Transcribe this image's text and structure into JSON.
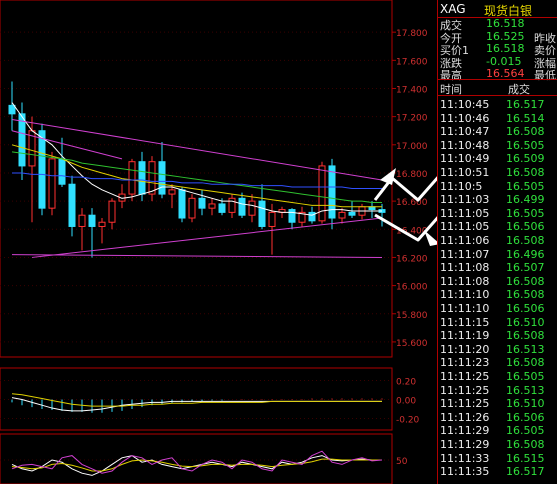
{
  "quote": {
    "code": "XAG",
    "name": "现货白银",
    "rows": [
      {
        "label": "成交",
        "value": "16.518",
        "extra": ""
      },
      {
        "label": "今开",
        "value": "16.525",
        "extra": "昨收"
      },
      {
        "label": "买价1",
        "value": "16.518",
        "extra": "卖价"
      },
      {
        "label": "涨跌",
        "value": "-0.015",
        "extra": "涨幅"
      },
      {
        "label": "最高",
        "value": "16.564",
        "extra": "最低"
      }
    ]
  },
  "ticks": {
    "header_time": "时间",
    "header_price": "成交",
    "rows": [
      {
        "time": "11:10:45",
        "price": "16.517"
      },
      {
        "time": "11:10:46",
        "price": "16.514"
      },
      {
        "time": "11:10:47",
        "price": "16.508"
      },
      {
        "time": "11:10:48",
        "price": "16.505"
      },
      {
        "time": "11:10:49",
        "price": "16.509"
      },
      {
        "time": "11:10:51",
        "price": "16.508"
      },
      {
        "time": "11:10:5",
        "price": "16.505"
      },
      {
        "time": "11:11:03",
        "price": "16.499"
      },
      {
        "time": "11:11:05",
        "price": "16.505"
      },
      {
        "time": "11:11:05",
        "price": "16.506"
      },
      {
        "time": "11:11:06",
        "price": "16.508"
      },
      {
        "time": "11:11:07",
        "price": "16.496"
      },
      {
        "time": "11:11:08",
        "price": "16.507"
      },
      {
        "time": "11:11:08",
        "price": "16.508"
      },
      {
        "time": "11:11:10",
        "price": "16.508"
      },
      {
        "time": "11:11:10",
        "price": "16.506"
      },
      {
        "time": "11:11:15",
        "price": "16.510"
      },
      {
        "time": "11:11:19",
        "price": "16.508"
      },
      {
        "time": "11:11:20",
        "price": "16.513"
      },
      {
        "time": "11:11:23",
        "price": "16.508"
      },
      {
        "time": "11:11:25",
        "price": "16.505"
      },
      {
        "time": "11:11:25",
        "price": "16.513"
      },
      {
        "time": "11:11:25",
        "price": "16.510"
      },
      {
        "time": "11:11:26",
        "price": "16.506"
      },
      {
        "time": "11:11:29",
        "price": "16.505"
      },
      {
        "time": "11:11:29",
        "price": "16.508"
      },
      {
        "time": "11:11:33",
        "price": "16.515"
      },
      {
        "time": "11:11:35",
        "price": "16.517"
      }
    ]
  },
  "chart_data": [
    {
      "type": "candlestick",
      "ylim": [
        15.5,
        18.0
      ],
      "yticks": [
        "17.800",
        "17.600",
        "17.400",
        "17.200",
        "17.000",
        "16.800",
        "16.600",
        "16.400",
        "16.200",
        "16.000",
        "15.800",
        "15.600"
      ],
      "candles": [
        {
          "o": 17.28,
          "h": 17.45,
          "l": 17.1,
          "c": 17.22
        },
        {
          "o": 17.22,
          "h": 17.3,
          "l": 16.75,
          "c": 16.85
        },
        {
          "o": 16.85,
          "h": 17.2,
          "l": 16.45,
          "c": 17.1
        },
        {
          "o": 17.1,
          "h": 17.15,
          "l": 16.5,
          "c": 16.55
        },
        {
          "o": 16.55,
          "h": 16.95,
          "l": 16.5,
          "c": 16.9
        },
        {
          "o": 16.9,
          "h": 17.05,
          "l": 16.7,
          "c": 16.72
        },
        {
          "o": 16.72,
          "h": 16.78,
          "l": 16.35,
          "c": 16.42
        },
        {
          "o": 16.42,
          "h": 16.55,
          "l": 16.25,
          "c": 16.5
        },
        {
          "o": 16.5,
          "h": 16.55,
          "l": 16.2,
          "c": 16.42
        },
        {
          "o": 16.42,
          "h": 16.48,
          "l": 16.3,
          "c": 16.45
        },
        {
          "o": 16.45,
          "h": 16.62,
          "l": 16.4,
          "c": 16.6
        },
        {
          "o": 16.6,
          "h": 16.72,
          "l": 16.55,
          "c": 16.65
        },
        {
          "o": 16.65,
          "h": 16.9,
          "l": 16.6,
          "c": 16.88
        },
        {
          "o": 16.88,
          "h": 16.95,
          "l": 16.6,
          "c": 16.65
        },
        {
          "o": 16.65,
          "h": 16.92,
          "l": 16.6,
          "c": 16.88
        },
        {
          "o": 16.88,
          "h": 17.02,
          "l": 16.62,
          "c": 16.65
        },
        {
          "o": 16.65,
          "h": 16.72,
          "l": 16.55,
          "c": 16.68
        },
        {
          "o": 16.68,
          "h": 16.7,
          "l": 16.45,
          "c": 16.48
        },
        {
          "o": 16.48,
          "h": 16.65,
          "l": 16.45,
          "c": 16.62
        },
        {
          "o": 16.62,
          "h": 16.68,
          "l": 16.5,
          "c": 16.55
        },
        {
          "o": 16.55,
          "h": 16.62,
          "l": 16.5,
          "c": 16.58
        },
        {
          "o": 16.58,
          "h": 16.62,
          "l": 16.5,
          "c": 16.52
        },
        {
          "o": 16.52,
          "h": 16.65,
          "l": 16.48,
          "c": 16.62
        },
        {
          "o": 16.62,
          "h": 16.66,
          "l": 16.48,
          "c": 16.5
        },
        {
          "o": 16.5,
          "h": 16.65,
          "l": 16.45,
          "c": 16.6
        },
        {
          "o": 16.6,
          "h": 16.72,
          "l": 16.4,
          "c": 16.42
        },
        {
          "o": 16.42,
          "h": 16.58,
          "l": 16.22,
          "c": 16.52
        },
        {
          "o": 16.52,
          "h": 16.56,
          "l": 16.48,
          "c": 16.54
        },
        {
          "o": 16.54,
          "h": 16.55,
          "l": 16.4,
          "c": 16.45
        },
        {
          "o": 16.45,
          "h": 16.56,
          "l": 16.42,
          "c": 16.52
        },
        {
          "o": 16.52,
          "h": 16.56,
          "l": 16.44,
          "c": 16.46
        },
        {
          "o": 16.46,
          "h": 16.88,
          "l": 16.44,
          "c": 16.85
        },
        {
          "o": 16.85,
          "h": 16.9,
          "l": 16.4,
          "c": 16.48
        },
        {
          "o": 16.48,
          "h": 16.55,
          "l": 16.44,
          "c": 16.52
        },
        {
          "o": 16.52,
          "h": 16.6,
          "l": 16.48,
          "c": 16.5
        },
        {
          "o": 16.5,
          "h": 16.58,
          "l": 16.47,
          "c": 16.56
        },
        {
          "o": 16.56,
          "h": 16.6,
          "l": 16.48,
          "c": 16.54
        },
        {
          "o": 16.54,
          "h": 16.58,
          "l": 16.42,
          "c": 16.52
        }
      ],
      "ma_lines": [
        {
          "color": "#ffffff",
          "values": [
            17.3,
            17.2,
            17.1,
            17.05,
            17.0,
            16.92,
            16.85,
            16.78,
            16.72,
            16.68,
            16.65,
            16.62,
            16.63,
            16.65,
            16.67,
            16.7,
            16.7,
            16.68,
            16.66,
            16.64,
            16.62,
            16.6,
            16.6,
            16.58,
            16.57,
            16.55,
            16.53,
            16.52,
            16.52,
            16.51,
            16.5,
            16.53,
            16.54,
            16.54,
            16.53,
            16.53,
            16.53,
            16.53
          ]
        },
        {
          "color": "#e0d000",
          "values": [
            17.0,
            16.98,
            16.96,
            16.94,
            16.92,
            16.9,
            16.87,
            16.84,
            16.82,
            16.8,
            16.78,
            16.76,
            16.75,
            16.74,
            16.73,
            16.72,
            16.71,
            16.7,
            16.69,
            16.68,
            16.67,
            16.66,
            16.65,
            16.64,
            16.63,
            16.62,
            16.61,
            16.6,
            16.59,
            16.58,
            16.57,
            16.57,
            16.57,
            16.56,
            16.56,
            16.56,
            16.56,
            16.56
          ]
        },
        {
          "color": "#2fc02f",
          "values": [
            16.95,
            16.94,
            16.93,
            16.92,
            16.91,
            16.9,
            16.89,
            16.87,
            16.86,
            16.85,
            16.84,
            16.83,
            16.82,
            16.81,
            16.8,
            16.79,
            16.78,
            16.77,
            16.76,
            16.75,
            16.74,
            16.73,
            16.72,
            16.71,
            16.7,
            16.69,
            16.68,
            16.67,
            16.66,
            16.65,
            16.64,
            16.63,
            16.62,
            16.61,
            16.6,
            16.6,
            16.59,
            16.59
          ]
        },
        {
          "color": "#3050ff",
          "values": [
            16.8,
            16.8,
            16.79,
            16.79,
            16.78,
            16.78,
            16.77,
            16.77,
            16.76,
            16.76,
            16.76,
            16.75,
            16.75,
            16.75,
            16.74,
            16.74,
            16.74,
            16.73,
            16.73,
            16.73,
            16.72,
            16.72,
            16.72,
            16.72,
            16.71,
            16.71,
            16.71,
            16.71,
            16.7,
            16.7,
            16.7,
            16.7,
            16.7,
            16.7,
            16.69,
            16.69,
            16.69,
            16.69
          ]
        }
      ],
      "trend_lines": [
        {
          "color": "#d040d0",
          "from": [
            0,
            17.18
          ],
          "to": [
            37,
            16.75
          ]
        },
        {
          "color": "#d040d0",
          "from": [
            2,
            16.2
          ],
          "to": [
            37,
            16.48
          ]
        },
        {
          "color": "#d040d0",
          "from": [
            0,
            16.22
          ],
          "to": [
            37,
            16.2
          ]
        },
        {
          "color": "#d040d0",
          "from": [
            0,
            17.1
          ],
          "to": [
            11,
            16.9
          ]
        }
      ]
    },
    {
      "type": "bar",
      "ylim": [
        -0.3,
        0.3
      ],
      "yticks": [
        "0.20",
        "0.00",
        "-0.20"
      ],
      "values": [
        -0.03,
        -0.06,
        -0.08,
        -0.1,
        -0.11,
        -0.12,
        -0.13,
        -0.13,
        -0.14,
        -0.14,
        -0.13,
        -0.12,
        -0.1,
        -0.08,
        -0.06,
        -0.05,
        -0.04,
        -0.03,
        -0.02,
        -0.02,
        -0.01,
        -0.01,
        0.0,
        0.005,
        0.005,
        0.005,
        0.005,
        0.005,
        0.005,
        0.005,
        0.01,
        0.01,
        0.01,
        0.01,
        0.01,
        0.01,
        0.01,
        0.01
      ],
      "lines": [
        {
          "color": "#ffffff",
          "values": [
            0.02,
            0.0,
            -0.03,
            -0.06,
            -0.09,
            -0.11,
            -0.12,
            -0.12,
            -0.11,
            -0.1,
            -0.08,
            -0.06,
            -0.05,
            -0.04,
            -0.03,
            -0.03,
            -0.02,
            -0.02,
            -0.02,
            -0.02,
            -0.02,
            -0.02,
            -0.02,
            -0.02,
            -0.02,
            -0.02,
            -0.02,
            -0.02,
            -0.02,
            -0.02,
            -0.02,
            -0.02,
            -0.02,
            -0.02,
            -0.02,
            -0.02,
            -0.02,
            -0.02
          ]
        },
        {
          "color": "#e0d000",
          "values": [
            0.06,
            0.05,
            0.03,
            0.01,
            -0.01,
            -0.03,
            -0.05,
            -0.06,
            -0.07,
            -0.07,
            -0.07,
            -0.07,
            -0.06,
            -0.06,
            -0.05,
            -0.05,
            -0.04,
            -0.04,
            -0.04,
            -0.03,
            -0.03,
            -0.03,
            -0.03,
            -0.03,
            -0.03,
            -0.03,
            -0.02,
            -0.02,
            -0.02,
            -0.02,
            -0.02,
            -0.02,
            -0.02,
            -0.02,
            -0.02,
            -0.02,
            -0.02,
            -0.02
          ]
        }
      ]
    },
    {
      "type": "line",
      "ylim": [
        0,
        100
      ],
      "yticks": [
        "50"
      ],
      "series": [
        {
          "color": "#ffffff",
          "values": [
            40,
            30,
            25,
            35,
            50,
            45,
            30,
            20,
            15,
            25,
            40,
            55,
            60,
            45,
            50,
            40,
            35,
            30,
            35,
            40,
            45,
            40,
            35,
            45,
            40,
            35,
            30,
            45,
            40,
            45,
            55,
            60,
            50,
            48,
            50,
            52,
            50,
            50
          ]
        },
        {
          "color": "#e0d000",
          "values": [
            35,
            33,
            30,
            32,
            40,
            42,
            38,
            32,
            25,
            25,
            30,
            40,
            48,
            50,
            48,
            45,
            40,
            36,
            35,
            37,
            40,
            40,
            38,
            40,
            40,
            38,
            35,
            38,
            40,
            42,
            46,
            52,
            52,
            50,
            50,
            50,
            50,
            50
          ]
        },
        {
          "color": "#d040d0",
          "values": [
            30,
            38,
            40,
            35,
            30,
            55,
            60,
            40,
            30,
            20,
            25,
            45,
            60,
            55,
            40,
            50,
            55,
            30,
            25,
            40,
            50,
            45,
            30,
            50,
            45,
            30,
            25,
            50,
            45,
            40,
            60,
            70,
            45,
            40,
            50,
            55,
            48,
            50
          ]
        }
      ]
    }
  ]
}
